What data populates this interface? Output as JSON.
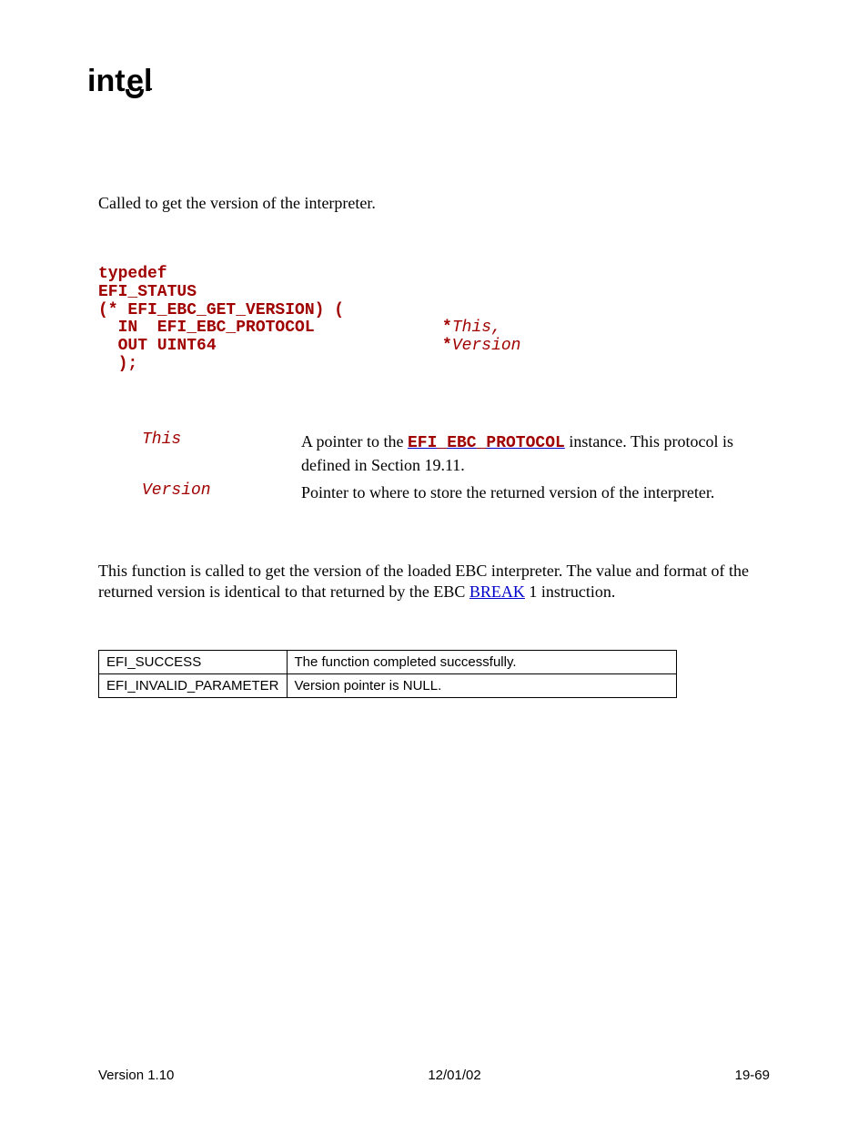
{
  "summary": "Called to get the version of the interpreter.",
  "prototype": {
    "l1": "typedef",
    "l2": "EFI_STATUS",
    "l3": "(* EFI_EBC_GET_VERSION) (",
    "l4a": "  IN  EFI_EBC_PROTOCOL             *",
    "l4b": "This,",
    "l5a": "  OUT UINT64                       *",
    "l5b": "Version",
    "l6": "  );"
  },
  "params": [
    {
      "name": "This",
      "pre": "A pointer to the ",
      "code": "EFI_EBC_PROTOCOL",
      "post": " instance.  This protocol is defined in Section 19.11."
    },
    {
      "name": "Version",
      "pre": "Pointer to where to store the returned version of the interpreter.",
      "code": "",
      "post": ""
    }
  ],
  "description": {
    "pre": "This function is called to get the version of the loaded EBC interpreter. The value and format of the returned version is identical to that returned by the EBC ",
    "link": "BREAK",
    "post": " 1 instruction."
  },
  "status_codes": [
    {
      "code": "EFI_SUCCESS",
      "desc": "The function completed successfully."
    },
    {
      "code": "EFI_INVALID_PARAMETER",
      "desc": "Version pointer is NULL."
    }
  ],
  "footer": {
    "left": "Version 1.10",
    "center": "12/01/02",
    "right": "19-69"
  }
}
